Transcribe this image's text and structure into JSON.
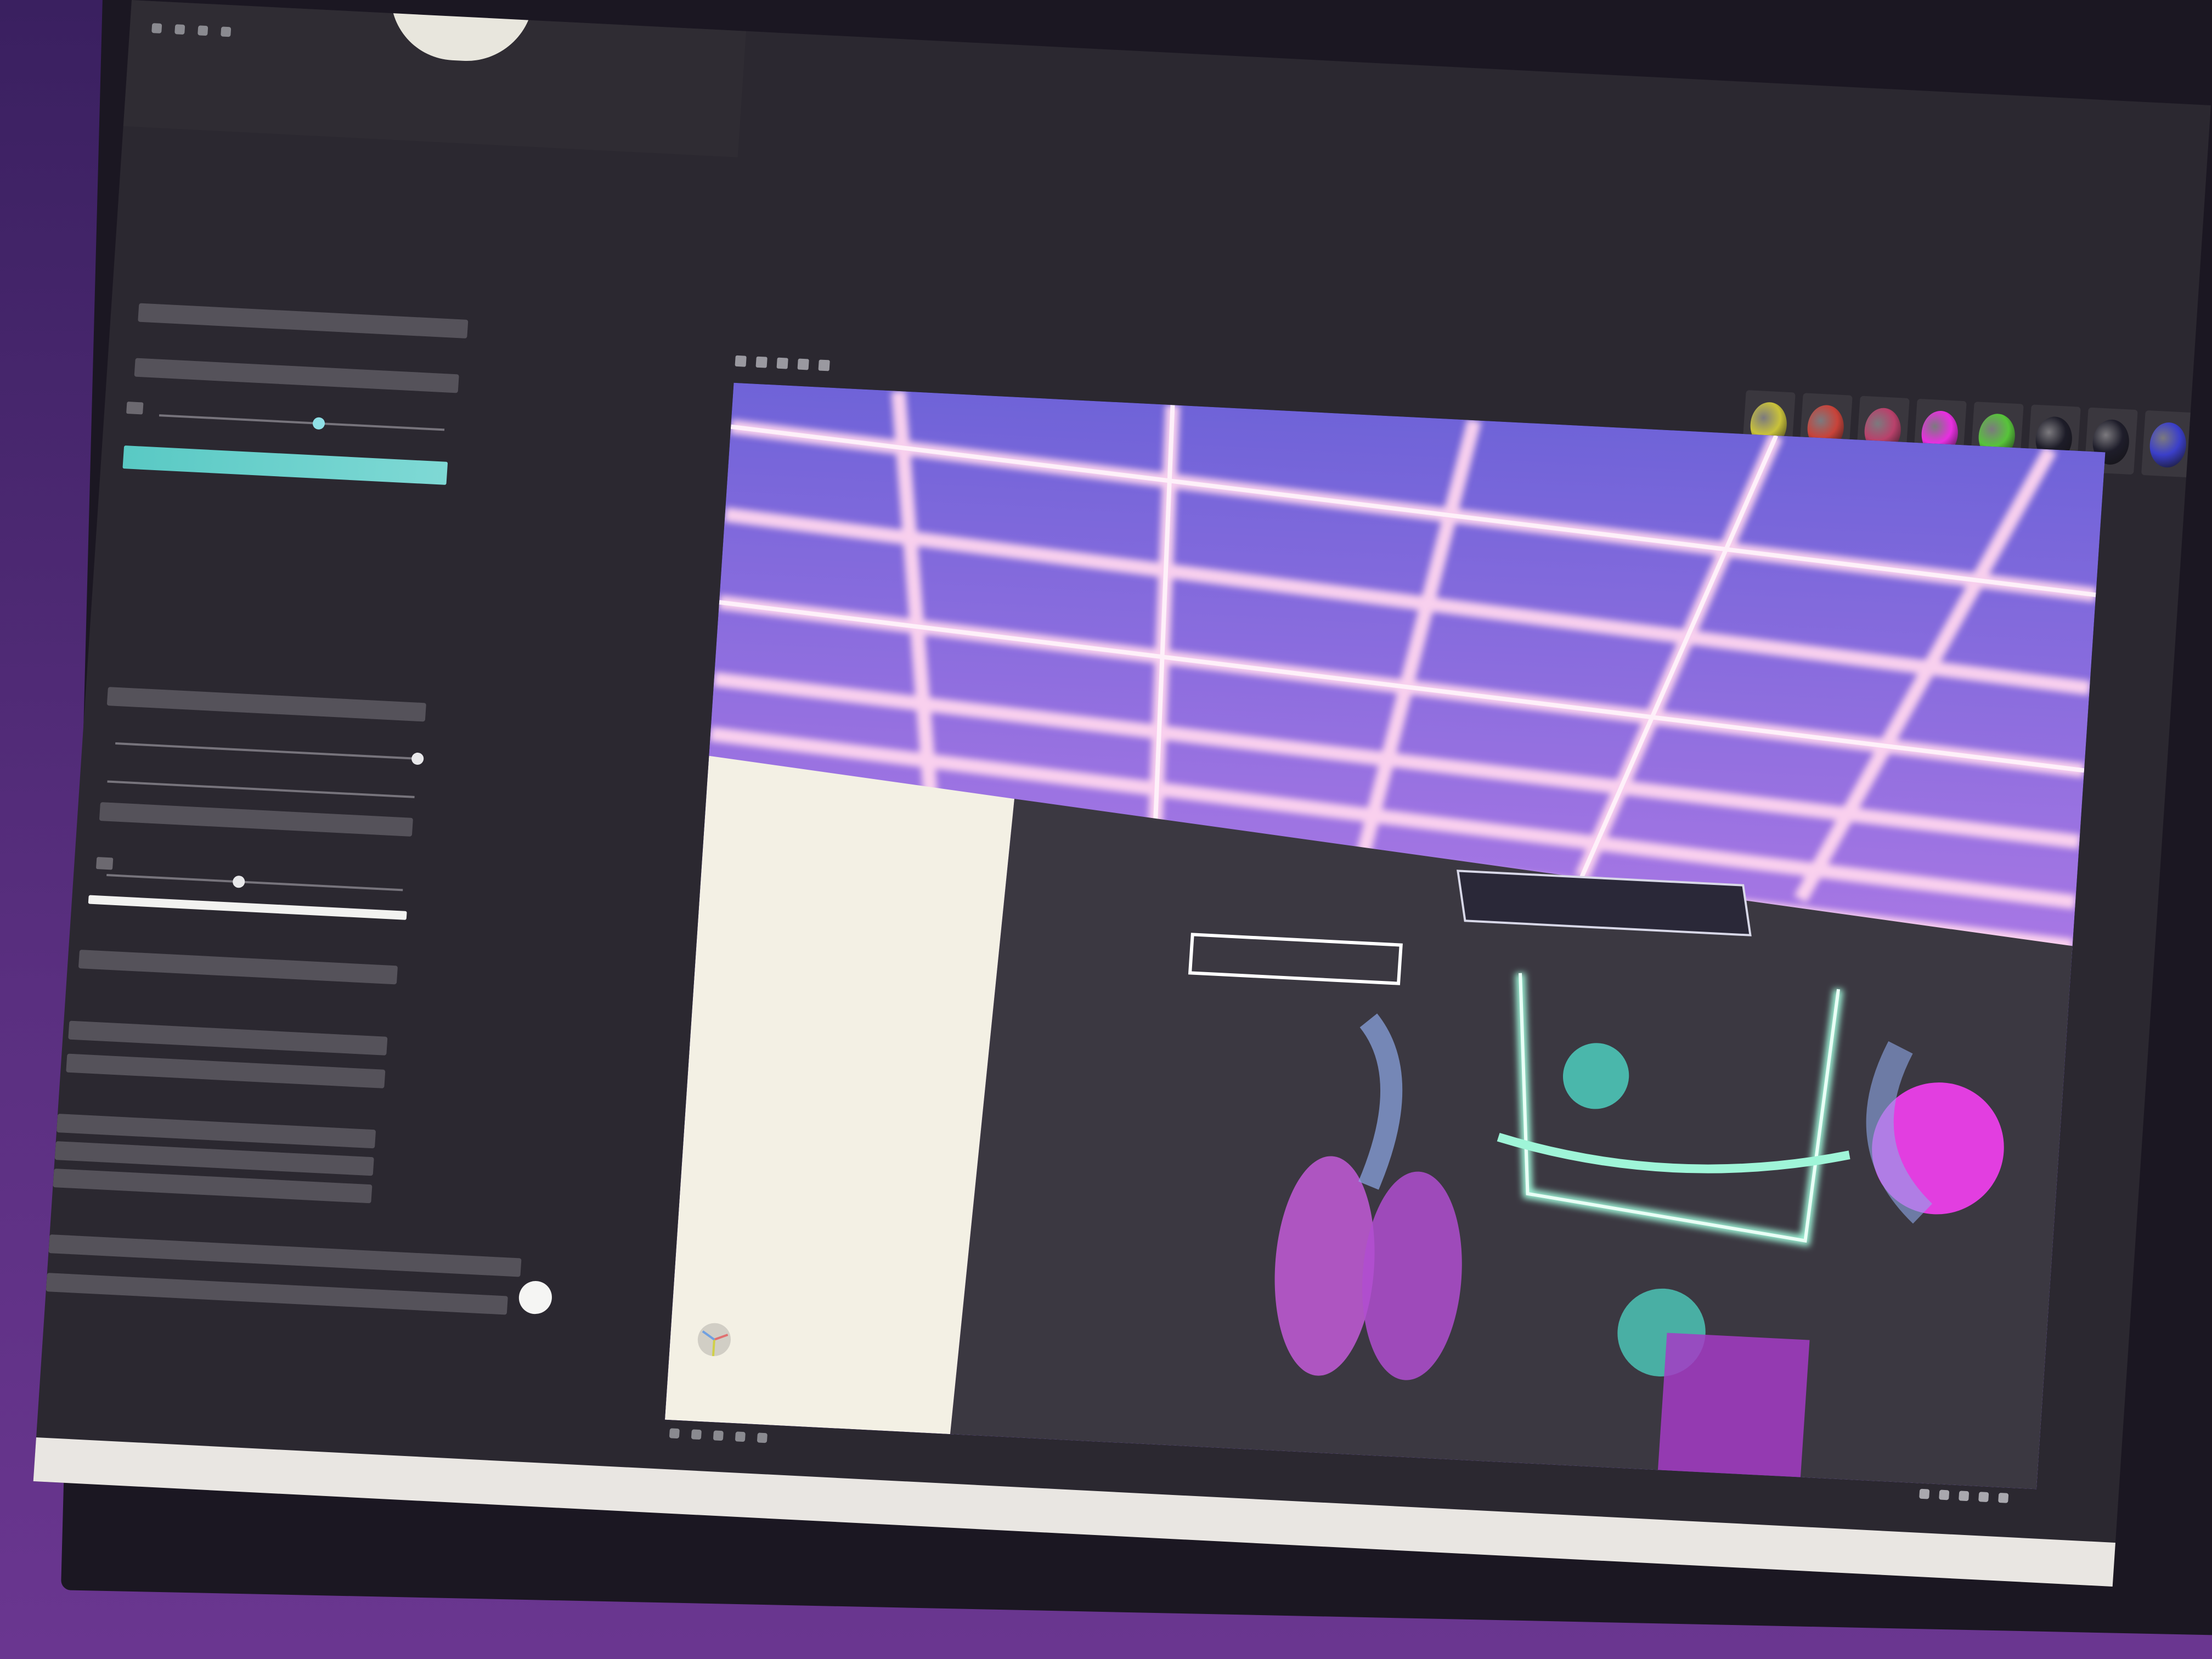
{
  "app": {
    "top_label": "",
    "timeline_text": ""
  },
  "left_panel": {
    "rows": [
      "",
      "",
      "",
      "",
      "",
      "",
      "",
      "",
      "",
      "",
      "",
      "",
      "",
      "",
      ""
    ],
    "accent_color": "#59c9c4"
  },
  "labels": [
    "",
    "",
    "",
    "",
    "",
    "",
    "",
    "",
    "",
    "",
    "",
    "",
    "",
    "",
    "",
    "",
    "",
    "",
    "",
    "",
    "",
    "",
    "",
    "",
    "",
    ""
  ],
  "swatches": [
    {
      "name": "",
      "color": "#c9c23a"
    },
    {
      "name": "",
      "color": "#c8433a"
    },
    {
      "name": "",
      "color": "#b9416b"
    },
    {
      "name": "",
      "color": "#e82fe0"
    },
    {
      "name": "",
      "color": "#57c43a"
    },
    {
      "name": "",
      "color": "#1d1c28"
    },
    {
      "name": "",
      "color": "#1e1d2a"
    },
    {
      "name": "",
      "color": "#3b3fc9"
    },
    {
      "name": "",
      "color": "#f2f2f2"
    }
  ],
  "viewport": {
    "sky_top": "#6f63d8",
    "sky_bottom": "#c77ee6",
    "grid_color": "#ffd6ef",
    "wall_color": "#f3f0e4",
    "floor_color": "#3b3841",
    "accent_magenta": "#e23ee0",
    "accent_teal": "#4fd7c6",
    "frame_color": "#9ff5d8"
  }
}
